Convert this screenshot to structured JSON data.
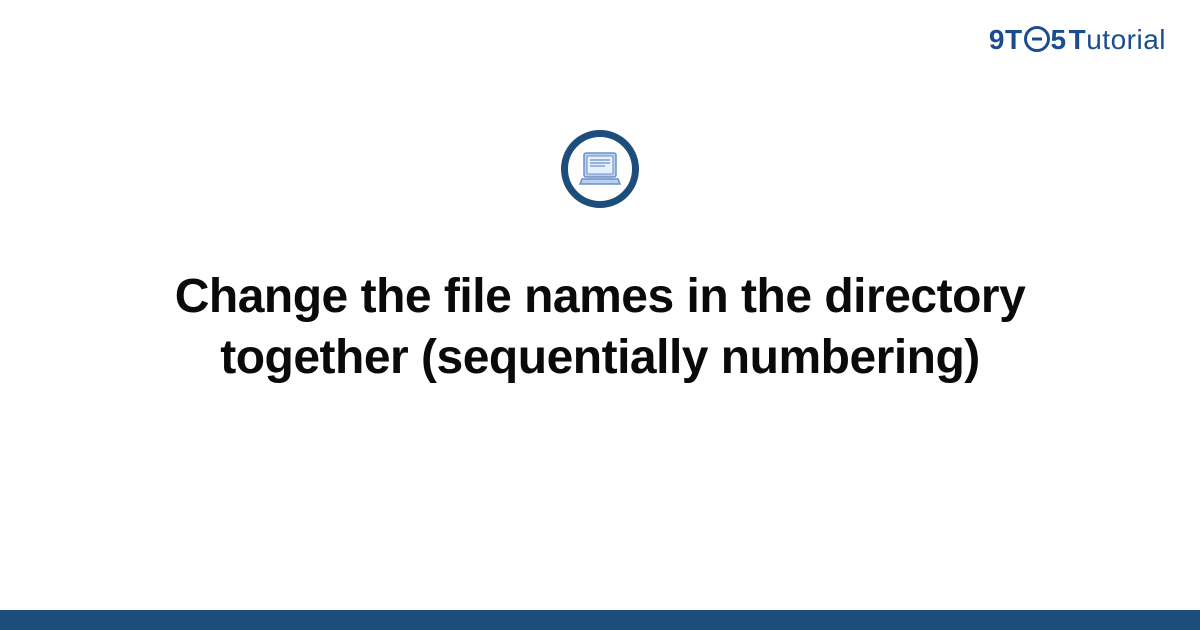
{
  "brand": {
    "nine": "9",
    "t1": "T",
    "five": "5",
    "t2": "T",
    "utorial": "utorial"
  },
  "page": {
    "title": "Change the file names in the directory together (sequentially numbering)"
  },
  "colors": {
    "brand_blue": "#1a4d8f",
    "ring_blue": "#1d4d7a",
    "icon_fill": "#bcd0ef",
    "icon_stroke": "#6a8fc8"
  }
}
